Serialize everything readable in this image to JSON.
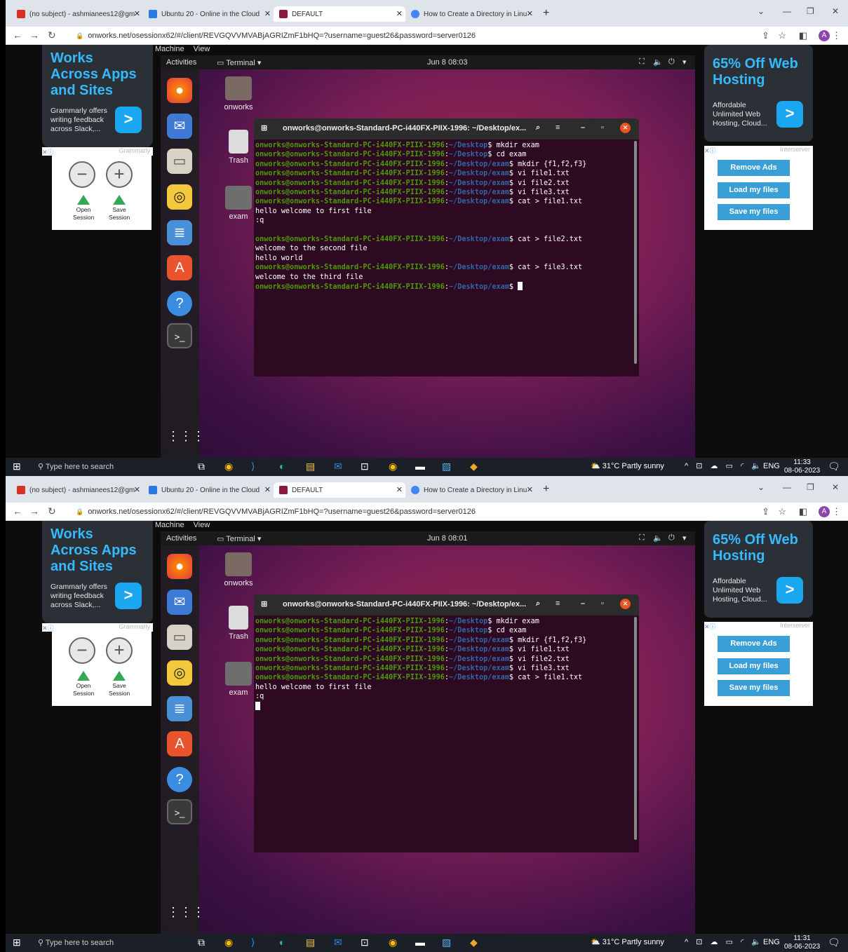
{
  "browser": {
    "tabs": [
      {
        "label": "(no subject) - ashmianees12@gm",
        "color": "#d93025"
      },
      {
        "label": "Ubuntu 20 - Online in the Cloud",
        "color": "#2a7ae2"
      },
      {
        "label": "DEFAULT",
        "color": "#8b1a3a"
      },
      {
        "label": "How to Create a Directory in Linu",
        "color": "#4285f4"
      }
    ],
    "new_tab": "+",
    "url": "onworks.net/osessionx62/#/client/REVGQVVMVABjAGRIZmF1bHQ=?username=guest26&password=server0126",
    "avatar": "A",
    "icons": [
      "back-icon",
      "forward-icon",
      "reload-icon",
      "lock-icon",
      "share-icon",
      "star-icon",
      "sidepanel-icon",
      "menu-icon"
    ]
  },
  "ads": {
    "left_title": "Works Across Apps and Sites",
    "left_text": "Grammarly offers writing feedback across Slack,...",
    "left_sponsor": "Grammarly",
    "right_title": "65% Off Web Hosting",
    "right_text": "Affordable Unlimited Web Hosting, Cloud...",
    "right_sponsor": "Interserver",
    "chevron": ">"
  },
  "session": {
    "zoom_out": "−",
    "zoom_in": "+",
    "open": "Open Session",
    "save": "Save Session"
  },
  "side_buttons": [
    "Remove Ads",
    "Load my files",
    "Save my files"
  ],
  "vm_menu": [
    "Machine",
    "View"
  ],
  "ubuntu": {
    "activities": "Activities",
    "app_menu": "Terminal ▾",
    "desktop": [
      "onworks",
      "Trash",
      "exam"
    ]
  },
  "terminal": {
    "title": "onworks@onworks-Standard-PC-i440FX-PIIX-1996: ~/Desktop/ex...",
    "user": "onworks@onworks-Standard-PC-i440FX-PIIX-1996",
    "path_desktop": "~/Desktop",
    "path_exam": "~/Desktop/exam"
  },
  "screens": [
    {
      "clock": "Jun 8  08:03",
      "time": "11:33",
      "date": "08-06-2023",
      "lines": [
        {
          "type": "cmd",
          "path": "~/Desktop",
          "cmd": "mkdir exam"
        },
        {
          "type": "cmd",
          "path": "~/Desktop",
          "cmd": "cd exam"
        },
        {
          "type": "cmd",
          "path": "~/Desktop/exam",
          "cmd": "mkdir {f1,f2,f3}"
        },
        {
          "type": "cmd",
          "path": "~/Desktop/exam",
          "cmd": "vi file1.txt"
        },
        {
          "type": "cmd",
          "path": "~/Desktop/exam",
          "cmd": "vi file2.txt"
        },
        {
          "type": "cmd",
          "path": "~/Desktop/exam",
          "cmd": "vi file3.txt"
        },
        {
          "type": "cmd",
          "path": "~/Desktop/exam",
          "cmd": "cat > file1.txt"
        },
        {
          "type": "out",
          "text": "hello welcome to first file"
        },
        {
          "type": "out",
          "text": ":q"
        },
        {
          "type": "out",
          "text": ""
        },
        {
          "type": "cmd",
          "path": "~/Desktop/exam",
          "cmd": "cat > file2.txt"
        },
        {
          "type": "out",
          "text": "welcome to the second file"
        },
        {
          "type": "out",
          "text": "hello world"
        },
        {
          "type": "cmd",
          "path": "~/Desktop/exam",
          "cmd": "cat > file3.txt"
        },
        {
          "type": "out",
          "text": "welcome to the third file"
        },
        {
          "type": "cmd",
          "path": "~/Desktop/exam",
          "cmd": "",
          "cursor": true
        }
      ]
    },
    {
      "clock": "Jun 8  08:01",
      "time": "11:31",
      "date": "08-06-2023",
      "lines": [
        {
          "type": "cmd",
          "path": "~/Desktop",
          "cmd": "mkdir exam"
        },
        {
          "type": "cmd",
          "path": "~/Desktop",
          "cmd": "cd exam"
        },
        {
          "type": "cmd",
          "path": "~/Desktop/exam",
          "cmd": "mkdir {f1,f2,f3}"
        },
        {
          "type": "cmd",
          "path": "~/Desktop/exam",
          "cmd": "vi file1.txt"
        },
        {
          "type": "cmd",
          "path": "~/Desktop/exam",
          "cmd": "vi file2.txt"
        },
        {
          "type": "cmd",
          "path": "~/Desktop/exam",
          "cmd": "vi file3.txt"
        },
        {
          "type": "cmd",
          "path": "~/Desktop/exam",
          "cmd": "cat > file1.txt"
        },
        {
          "type": "out",
          "text": "hello welcome to first file"
        },
        {
          "type": "out",
          "text": ":q"
        },
        {
          "type": "out",
          "text": "",
          "cursor": true
        }
      ]
    }
  ],
  "taskbar": {
    "search": "Type here to search",
    "weather": "31°C  Partly sunny",
    "lang": "ENG"
  }
}
